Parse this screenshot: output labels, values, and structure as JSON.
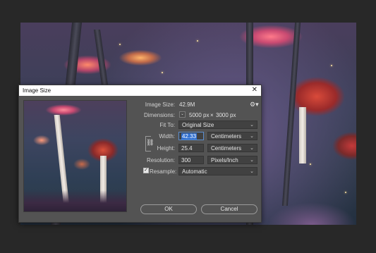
{
  "dialog": {
    "title": "Image Size",
    "close_glyph": "✕",
    "gear_glyph": "⚙▾",
    "image_size_label": "Image Size:",
    "image_size_value": "42.9M",
    "dimensions_label": "Dimensions:",
    "dimensions_width": "5000 px",
    "dimensions_sep": "×",
    "dimensions_height": "3000 px",
    "fit_to_label": "Fit To:",
    "fit_to_value": "Original Size",
    "width_label": "Width:",
    "width_value": "42.33",
    "width_unit": "Centimeters",
    "height_label": "Height:",
    "height_value": "25.4",
    "height_unit": "Centimeters",
    "resolution_label": "Resolution:",
    "resolution_value": "300",
    "resolution_unit": "Pixels/Inch",
    "resample_label": "Resample:",
    "resample_checked": true,
    "resample_value": "Automatic",
    "ok_label": "OK",
    "cancel_label": "Cancel"
  },
  "icons": {
    "chevron": "⌄",
    "chain": "⛓",
    "check": "✓"
  }
}
